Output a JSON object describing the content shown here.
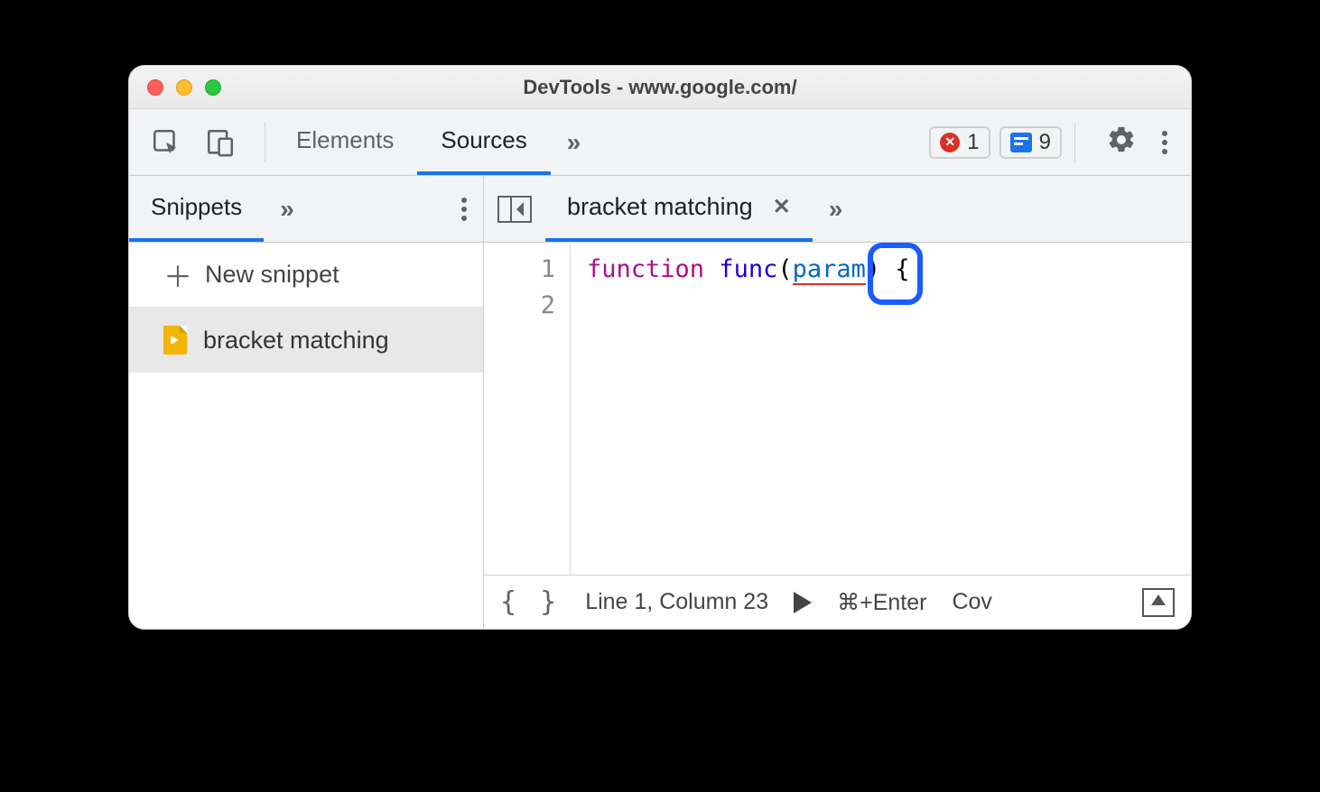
{
  "window": {
    "title": "DevTools - www.google.com/"
  },
  "toolbar": {
    "tabs": {
      "elements": "Elements",
      "sources": "Sources"
    },
    "more": "»",
    "errors_count": "1",
    "messages_count": "9"
  },
  "sidebar": {
    "tab": "Snippets",
    "more": "»",
    "new_snippet": "New snippet",
    "items": [
      {
        "label": "bracket matching"
      }
    ]
  },
  "editor": {
    "file_tab": "bracket matching",
    "more": "»",
    "line_numbers": [
      "1",
      "2"
    ],
    "code": {
      "keyword": "function",
      "func_name": "func",
      "open_paren": "(",
      "param": "param",
      "close_paren": ")",
      "space": " ",
      "brace": "{"
    }
  },
  "status": {
    "brackets": "{ }",
    "position": "Line 1, Column 23",
    "run_shortcut": "⌘+Enter",
    "coverage": "Cov"
  }
}
